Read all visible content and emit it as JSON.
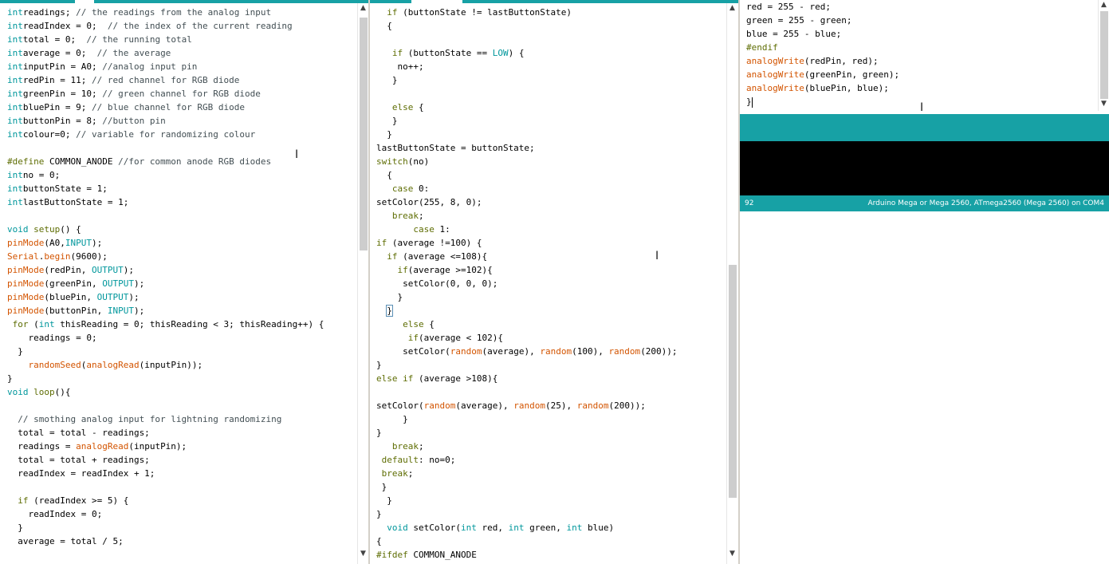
{
  "pane1": {
    "lines": [
      [
        [
          "kw",
          "int"
        ],
        [
          "",
          "readings; "
        ],
        [
          "cm",
          "// the readings from the analog input"
        ]
      ],
      [
        [
          "kw",
          "int"
        ],
        [
          "",
          "readIndex = 0;  "
        ],
        [
          "cm",
          "// the index of the current reading"
        ]
      ],
      [
        [
          "kw",
          "int"
        ],
        [
          "",
          "total = 0;  "
        ],
        [
          "cm",
          "// the running total"
        ]
      ],
      [
        [
          "kw",
          "int"
        ],
        [
          "",
          "average = 0;  "
        ],
        [
          "cm",
          "// the average"
        ]
      ],
      [
        [
          "kw",
          "int"
        ],
        [
          "",
          "inputPin = A0; "
        ],
        [
          "cm",
          "//analog input pin"
        ]
      ],
      [
        [
          "kw",
          "int"
        ],
        [
          "",
          "redPin = 11; "
        ],
        [
          "cm",
          "// red channel for RGB diode"
        ]
      ],
      [
        [
          "kw",
          "int"
        ],
        [
          "",
          "greenPin = 10; "
        ],
        [
          "cm",
          "// green channel for RGB diode"
        ]
      ],
      [
        [
          "kw",
          "int"
        ],
        [
          "",
          "bluePin = 9; "
        ],
        [
          "cm",
          "// blue channel for RGB diode"
        ]
      ],
      [
        [
          "kw",
          "int"
        ],
        [
          "",
          "buttonPin = 8; "
        ],
        [
          "cm",
          "//button pin"
        ]
      ],
      [
        [
          "kw",
          "int"
        ],
        [
          "",
          "colour=0; "
        ],
        [
          "cm",
          "// variable for randomizing colour"
        ]
      ],
      [],
      [
        [
          "pp",
          "#define"
        ],
        [
          "",
          " COMMON_ANODE "
        ],
        [
          "cm",
          "//for common anode RGB diodes"
        ]
      ],
      [
        [
          "kw",
          "int"
        ],
        [
          "",
          "no = 0;"
        ]
      ],
      [
        [
          "kw",
          "int"
        ],
        [
          "",
          "buttonState = 1;"
        ]
      ],
      [
        [
          "kw",
          "int"
        ],
        [
          "",
          "lastButtonState = 1;"
        ]
      ],
      [],
      [
        [
          "kw",
          "void"
        ],
        [
          "",
          " "
        ],
        [
          "pp",
          "setup"
        ],
        [
          "",
          "() {"
        ]
      ],
      [
        [
          "fn",
          "pinMode"
        ],
        [
          "",
          "(A0,"
        ],
        [
          "lit",
          "INPUT"
        ],
        [
          "",
          ");"
        ]
      ],
      [
        [
          "fn",
          "Serial"
        ],
        [
          "",
          "."
        ],
        [
          "fn",
          "begin"
        ],
        [
          "",
          "(9600);"
        ]
      ],
      [
        [
          "fn",
          "pinMode"
        ],
        [
          "",
          "(redPin, "
        ],
        [
          "lit",
          "OUTPUT"
        ],
        [
          "",
          ");"
        ]
      ],
      [
        [
          "fn",
          "pinMode"
        ],
        [
          "",
          "(greenPin, "
        ],
        [
          "lit",
          "OUTPUT"
        ],
        [
          "",
          ");"
        ]
      ],
      [
        [
          "fn",
          "pinMode"
        ],
        [
          "",
          "(bluePin, "
        ],
        [
          "lit",
          "OUTPUT"
        ],
        [
          "",
          ");"
        ]
      ],
      [
        [
          "fn",
          "pinMode"
        ],
        [
          "",
          "(buttonPin, "
        ],
        [
          "lit",
          "INPUT"
        ],
        [
          "",
          ");"
        ]
      ],
      [
        [
          "",
          "",
          " "
        ],
        [
          "pp",
          "for"
        ],
        [
          "",
          " ("
        ],
        [
          "kw",
          "int"
        ],
        [
          "",
          " thisReading = 0; thisReading < 3; thisReading++) {"
        ]
      ],
      [
        [
          "",
          "    readings = 0;"
        ]
      ],
      [
        [
          "",
          "  }"
        ]
      ],
      [
        [
          "",
          "    "
        ],
        [
          "fn",
          "randomSeed"
        ],
        [
          "",
          "("
        ],
        [
          "fn",
          "analogRead"
        ],
        [
          "",
          "(inputPin));"
        ]
      ],
      [
        [
          "",
          "}"
        ]
      ],
      [
        [
          "kw",
          "void"
        ],
        [
          "",
          " "
        ],
        [
          "pp",
          "loop"
        ],
        [
          "",
          "(){"
        ]
      ],
      [],
      [
        [
          "",
          "  "
        ],
        [
          "cm",
          "// smothing analog input for lightning randomizing"
        ]
      ],
      [
        [
          "",
          "  total = total - readings;"
        ]
      ],
      [
        [
          "",
          "  readings = "
        ],
        [
          "fn",
          "analogRead"
        ],
        [
          "",
          "(inputPin);"
        ]
      ],
      [
        [
          "",
          "  total = total + readings;"
        ]
      ],
      [
        [
          "",
          "  readIndex = readIndex + 1;"
        ]
      ],
      [],
      [
        [
          "",
          "  "
        ],
        [
          "pp",
          "if"
        ],
        [
          "",
          " (readIndex >= 5) {"
        ]
      ],
      [
        [
          "",
          "    readIndex = 0;"
        ]
      ],
      [
        [
          "",
          "  }"
        ]
      ],
      [
        [
          "",
          "  average = total / 5;"
        ]
      ]
    ]
  },
  "pane2": {
    "lines": [
      [
        [
          "",
          "  "
        ],
        [
          "pp",
          "if"
        ],
        [
          "",
          " (buttonState != lastButtonState)"
        ]
      ],
      [
        [
          "",
          "  {"
        ]
      ],
      [],
      [
        [
          "",
          "   "
        ],
        [
          "pp",
          "if"
        ],
        [
          "",
          " (buttonState == "
        ],
        [
          "lit",
          "LOW"
        ],
        [
          "",
          ") {"
        ]
      ],
      [
        [
          "",
          "    no++;"
        ]
      ],
      [
        [
          "",
          "   }"
        ]
      ],
      [],
      [
        [
          "",
          "   "
        ],
        [
          "pp",
          "else"
        ],
        [
          "",
          " {"
        ]
      ],
      [
        [
          "",
          "   }"
        ]
      ],
      [
        [
          "",
          "  }"
        ]
      ],
      [
        [
          "",
          "lastButtonState = buttonState;"
        ]
      ],
      [
        [
          "pp",
          "switch"
        ],
        [
          "",
          "(no)"
        ]
      ],
      [
        [
          "",
          "  {"
        ]
      ],
      [
        [
          "",
          "   "
        ],
        [
          "pp",
          "case"
        ],
        [
          "",
          " 0:"
        ]
      ],
      [
        [
          "",
          "setColor(255, 8, 0);"
        ]
      ],
      [
        [
          "",
          "   "
        ],
        [
          "pp",
          "break"
        ],
        [
          "",
          ";"
        ]
      ],
      [
        [
          "",
          "       "
        ],
        [
          "pp",
          "case"
        ],
        [
          "",
          " 1:"
        ]
      ],
      [
        [
          "pp",
          "if"
        ],
        [
          "",
          " (average !=100) {"
        ]
      ],
      [
        [
          "",
          "  "
        ],
        [
          "pp",
          "if"
        ],
        [
          "",
          " (average <=108){"
        ]
      ],
      [
        [
          "",
          "    "
        ],
        [
          "pp",
          "if"
        ],
        [
          "",
          "(average >=102){"
        ]
      ],
      [
        [
          "",
          "     setColor(0, 0, 0);"
        ]
      ],
      [
        [
          "",
          "    }"
        ]
      ],
      [
        [
          "",
          "  "
        ],
        [
          "hl",
          "}"
        ]
      ],
      [
        [
          "",
          "     "
        ],
        [
          "pp",
          "else"
        ],
        [
          "",
          " {"
        ]
      ],
      [
        [
          "",
          "      "
        ],
        [
          "pp",
          "if"
        ],
        [
          "",
          "(average < 102){"
        ]
      ],
      [
        [
          "",
          "     setColor("
        ],
        [
          "fn",
          "random"
        ],
        [
          "",
          "(average), "
        ],
        [
          "fn",
          "random"
        ],
        [
          "",
          "(100), "
        ],
        [
          "fn",
          "random"
        ],
        [
          "",
          "(200));"
        ]
      ],
      [
        [
          "",
          "}"
        ]
      ],
      [
        [
          "pp",
          "else"
        ],
        [
          "",
          " "
        ],
        [
          "pp",
          "if"
        ],
        [
          "",
          " (average >108){"
        ]
      ],
      [],
      [
        [
          "",
          "setColor("
        ],
        [
          "fn",
          "random"
        ],
        [
          "",
          "(average), "
        ],
        [
          "fn",
          "random"
        ],
        [
          "",
          "(25), "
        ],
        [
          "fn",
          "random"
        ],
        [
          "",
          "(200));"
        ]
      ],
      [
        [
          "",
          "     }"
        ]
      ],
      [
        [
          "",
          "}"
        ]
      ],
      [
        [
          "",
          "   "
        ],
        [
          "pp",
          "break"
        ],
        [
          "",
          ";"
        ]
      ],
      [
        [
          "",
          "",
          " "
        ],
        [
          "pp",
          "default"
        ],
        [
          "",
          ": no=0;"
        ]
      ],
      [
        [
          "",
          "",
          " "
        ],
        [
          "pp",
          "break"
        ],
        [
          "",
          ";"
        ]
      ],
      [
        [
          "",
          "",
          " }"
        ]
      ],
      [
        [
          "",
          "  }"
        ]
      ],
      [
        [
          "",
          "}"
        ]
      ],
      [
        [
          "",
          "  "
        ],
        [
          "kw",
          "void"
        ],
        [
          "",
          " setColor("
        ],
        [
          "kw",
          "int"
        ],
        [
          "",
          " red, "
        ],
        [
          "kw",
          "int"
        ],
        [
          "",
          " green, "
        ],
        [
          "kw",
          "int"
        ],
        [
          "",
          " blue)"
        ]
      ],
      [
        [
          "",
          "{"
        ]
      ],
      [
        [
          "pp",
          "#ifdef"
        ],
        [
          "",
          " COMMON_ANODE"
        ]
      ]
    ]
  },
  "pane3": {
    "lines": [
      [
        [
          "",
          "red = 255 - red;"
        ]
      ],
      [
        [
          "",
          "green = 255 - green;"
        ]
      ],
      [
        [
          "",
          "blue = 255 - blue;"
        ]
      ],
      [
        [
          "pp",
          "#endif"
        ]
      ],
      [
        [
          "fn",
          "analogWrite"
        ],
        [
          "",
          "(redPin, red);"
        ]
      ],
      [
        [
          "fn",
          "analogWrite"
        ],
        [
          "",
          "(greenPin, green);"
        ]
      ],
      [
        [
          "fn",
          "analogWrite"
        ],
        [
          "",
          "(bluePin, blue);"
        ]
      ],
      [
        [
          "caret",
          "}"
        ]
      ]
    ]
  },
  "status": {
    "line_number": "92",
    "board": "Arduino Mega or Mega 2560, ATmega2560 (Mega 2560) on COM4"
  },
  "colors": {
    "accent": "#17a1a5",
    "keyword": "#00979c",
    "function": "#d35400",
    "preprocessor": "#5e6d03",
    "comment": "#434f54"
  },
  "icons": {
    "scroll_up": "scroll-up-arrow-icon",
    "scroll_down": "scroll-down-arrow-icon",
    "mouse_cursor": "text-cursor-ibeam-icon"
  }
}
